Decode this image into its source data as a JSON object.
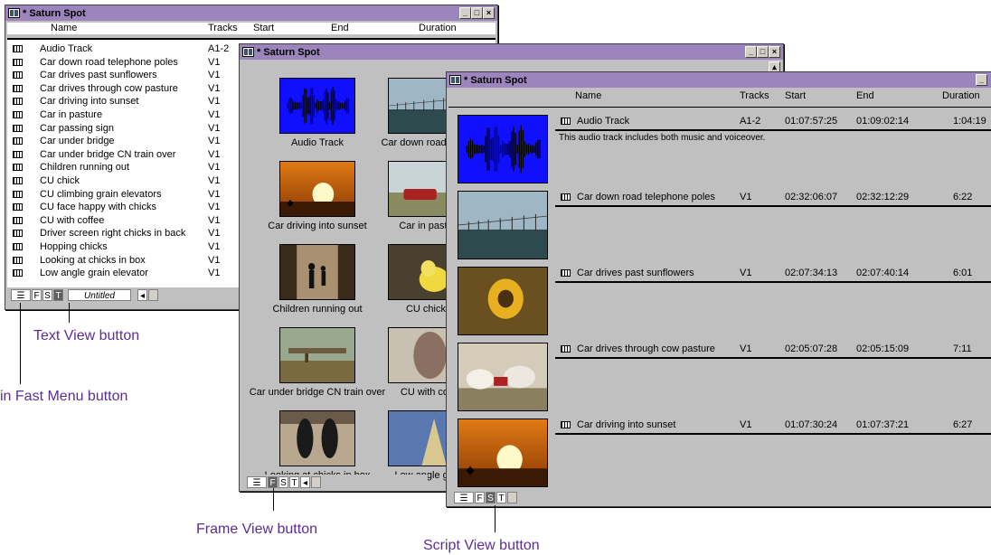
{
  "window_title": "* Saturn Spot",
  "window_buttons": {
    "minimize": "_",
    "maximize": "□",
    "close": "×"
  },
  "text_view": {
    "headers": {
      "name": "Name",
      "tracks": "Tracks",
      "start": "Start",
      "end": "End",
      "duration": "Duration"
    },
    "clips": [
      {
        "name": "Audio Track",
        "track": "A1-2"
      },
      {
        "name": "Car down road telephone poles",
        "track": "V1"
      },
      {
        "name": "Car drives past sunflowers",
        "track": "V1"
      },
      {
        "name": "Car drives through cow pasture",
        "track": "V1"
      },
      {
        "name": "Car driving into sunset",
        "track": "V1"
      },
      {
        "name": "Car in pasture",
        "track": "V1"
      },
      {
        "name": "Car passing sign",
        "track": "V1"
      },
      {
        "name": "Car under bridge",
        "track": "V1"
      },
      {
        "name": "Car under bridge CN train over",
        "track": "V1"
      },
      {
        "name": "Children running out",
        "track": "V1"
      },
      {
        "name": "CU chick",
        "track": "V1"
      },
      {
        "name": "CU climbing grain elevators",
        "track": "V1"
      },
      {
        "name": "CU face happy with chicks",
        "track": "V1"
      },
      {
        "name": "CU with coffee",
        "track": "V1"
      },
      {
        "name": "Driver screen right chicks in back",
        "track": "V1"
      },
      {
        "name": "Hopping chicks",
        "track": "V1"
      },
      {
        "name": "Looking at chicks in box",
        "track": "V1"
      },
      {
        "name": "Low angle grain elevator",
        "track": "V1"
      }
    ],
    "bottom": {
      "fast_menu": "☰",
      "f": "F",
      "s": "S",
      "t": "T",
      "view_name": "Untitled"
    }
  },
  "frame_view": {
    "items": [
      {
        "caption": "Audio Track",
        "thumb": "audio"
      },
      {
        "caption": "Car down road telep",
        "thumb": "poles"
      },
      {
        "caption": "Car driving into sunset",
        "thumb": "sunset"
      },
      {
        "caption": "Car in pastu",
        "thumb": "pasture"
      },
      {
        "caption": "Children running out",
        "thumb": "children"
      },
      {
        "caption": "CU chick",
        "thumb": "chick"
      },
      {
        "caption": "Car under bridge CN train over",
        "thumb": "bridge"
      },
      {
        "caption": "CU with cof",
        "thumb": "coffee"
      },
      {
        "caption": "Looking at chicks in box",
        "thumb": "chicksbox"
      },
      {
        "caption": "Low angle gra",
        "thumb": "grain"
      }
    ],
    "bottom": {
      "fast_menu": "☰",
      "f": "F",
      "s": "S",
      "t": "T"
    }
  },
  "script_view": {
    "headers": {
      "name": "Name",
      "tracks": "Tracks",
      "start": "Start",
      "end": "End",
      "duration": "Duration"
    },
    "entries": [
      {
        "name": "Audio Track",
        "track": "A1-2",
        "start": "01:07:57:25",
        "end": "01:09:02:14",
        "duration": "1:04:19",
        "note": "This audio track includes both music and voiceover.",
        "thumb": "audio"
      },
      {
        "name": "Car down road telephone poles",
        "track": "V1",
        "start": "02:32:06:07",
        "end": "02:32:12:29",
        "duration": "6:22",
        "note": "",
        "thumb": "poles"
      },
      {
        "name": "Car drives past sunflowers",
        "track": "V1",
        "start": "02:07:34:13",
        "end": "02:07:40:14",
        "duration": "6:01",
        "note": "",
        "thumb": "sunflower"
      },
      {
        "name": "Car drives through cow pasture",
        "track": "V1",
        "start": "02:05:07:28",
        "end": "02:05:15:09",
        "duration": "7:11",
        "note": "",
        "thumb": "cows"
      },
      {
        "name": "Car driving into sunset",
        "track": "V1",
        "start": "01:07:30:24",
        "end": "01:07:37:21",
        "duration": "6:27",
        "note": "",
        "thumb": "sunset"
      }
    ],
    "bottom": {
      "fast_menu": "☰",
      "f": "F",
      "s": "S",
      "t": "T"
    }
  },
  "callouts": {
    "text_view": "Text View button",
    "fast_menu": "in Fast Menu button",
    "frame_view": "Frame View button",
    "script_view": "Script View button"
  },
  "colors": {
    "titlebar": "#9c84bc",
    "callout": "#5b2d97",
    "audio_blue": "#1010ff"
  }
}
